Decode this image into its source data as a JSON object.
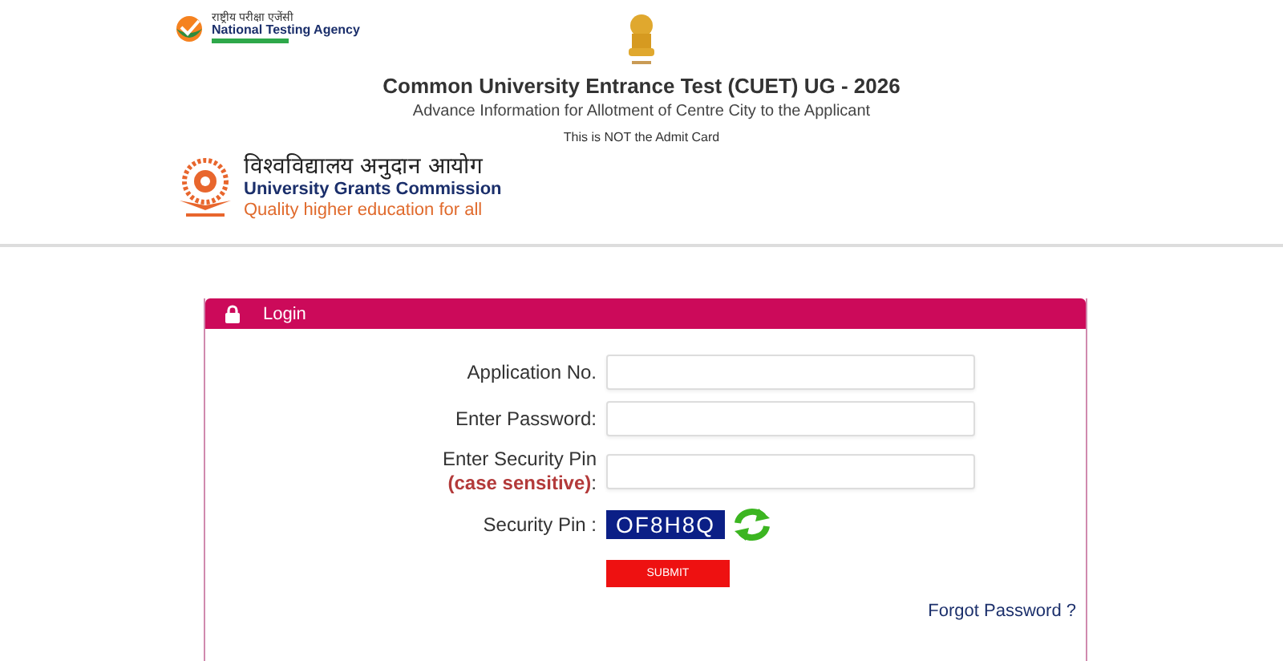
{
  "header": {
    "nta": {
      "hindi": "राष्ट्रीय परीक्षा एजेंसी",
      "name": "National Testing Agency"
    },
    "title": "Common University Entrance Test (CUET) UG - 2026",
    "subtitle": "Advance Information for Allotment of Centre City to the Applicant",
    "notice": "This is NOT the Admit Card",
    "ugc": {
      "hindi": "विश्वविद्यालय अनुदान आयोग",
      "name": "University Grants Commission",
      "tagline": "Quality higher education for all"
    }
  },
  "login": {
    "title": "Login",
    "fields": [
      {
        "kind": "input",
        "label": "Application No."
      },
      {
        "kind": "input",
        "label": "Enter Password:"
      },
      {
        "kind": "input",
        "label": "Enter Security Pin",
        "note": "(case sensitive)",
        "suffix": " :"
      },
      {
        "kind": "captcha",
        "label": "Security Pin :",
        "code": "OF8H8Q"
      }
    ],
    "submit": "SUBMIT",
    "forgot": "Forgot Password ?"
  }
}
